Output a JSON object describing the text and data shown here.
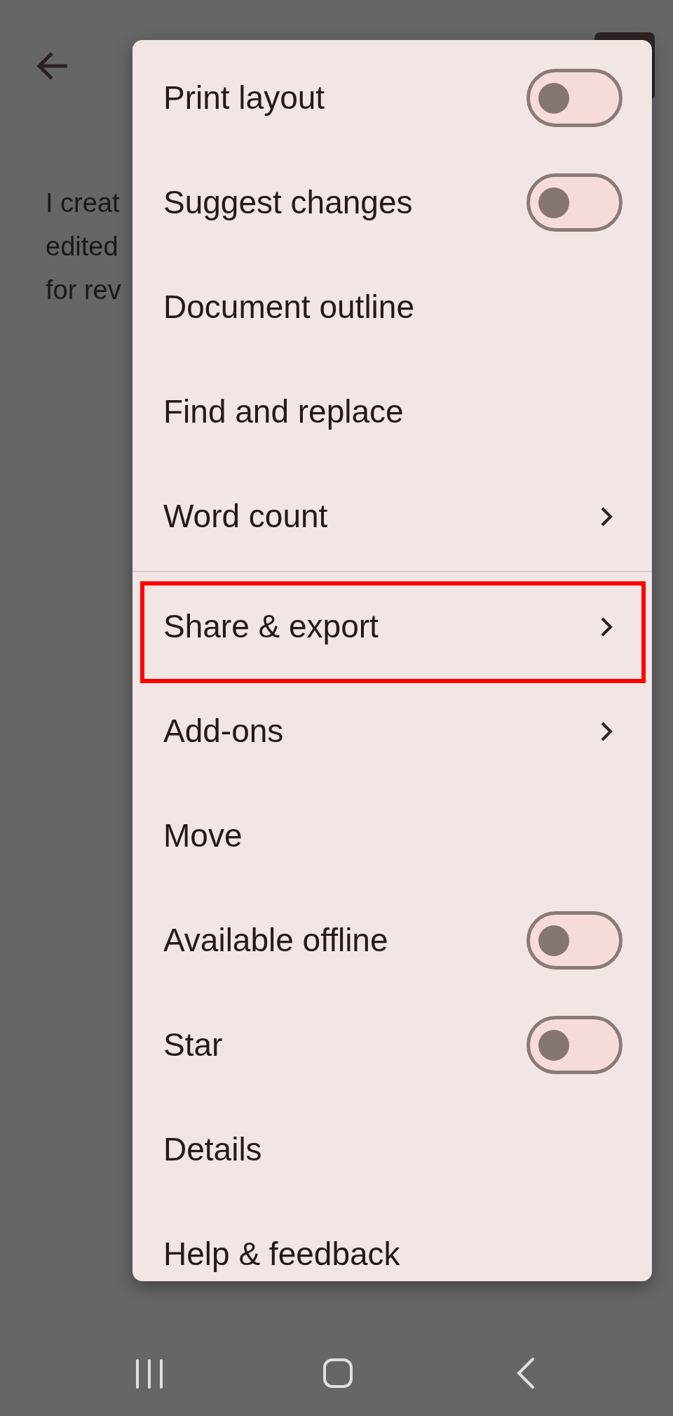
{
  "document": {
    "lines": [
      "I creat",
      "edited",
      "for rev"
    ]
  },
  "menu": {
    "items": [
      {
        "kind": "toggle",
        "label": "Print layout",
        "on": false
      },
      {
        "kind": "toggle",
        "label": "Suggest changes",
        "on": false
      },
      {
        "kind": "plain",
        "label": "Document outline"
      },
      {
        "kind": "plain",
        "label": "Find and replace"
      },
      {
        "kind": "submenu",
        "label": "Word count"
      },
      {
        "kind": "divider"
      },
      {
        "kind": "submenu",
        "label": "Share & export",
        "highlighted": true
      },
      {
        "kind": "submenu",
        "label": "Add-ons"
      },
      {
        "kind": "plain",
        "label": "Move"
      },
      {
        "kind": "toggle",
        "label": "Available offline",
        "on": false
      },
      {
        "kind": "toggle",
        "label": "Star",
        "on": false
      },
      {
        "kind": "plain",
        "label": "Details"
      },
      {
        "kind": "plain",
        "label": "Help & feedback"
      }
    ]
  }
}
